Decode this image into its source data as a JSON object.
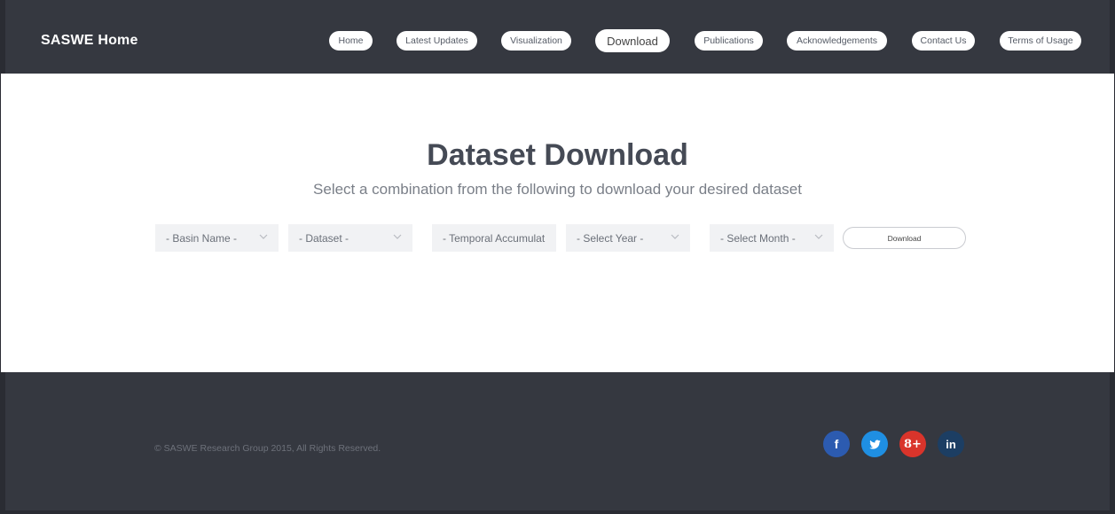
{
  "brand": "SASWE Home",
  "nav": {
    "items": [
      {
        "label": "Home"
      },
      {
        "label": "Latest Updates"
      },
      {
        "label": "Visualization"
      },
      {
        "label": "Download"
      },
      {
        "label": "Publications"
      },
      {
        "label": "Acknowledgements"
      },
      {
        "label": "Contact Us"
      },
      {
        "label": "Terms of Usage"
      }
    ],
    "active": "Download"
  },
  "main": {
    "title": "Dataset Download",
    "subtitle": "Select a combination from the following to download your desired dataset",
    "selects": {
      "basin": "- Basin Name -",
      "dataset": "- Dataset -",
      "temporal": "- Temporal Accumulat",
      "year": "- Select Year -",
      "month": "- Select Month -"
    },
    "download_label": "Download"
  },
  "footer": {
    "copyright": "© SASWE Research Group 2015, All Rights Reserved.",
    "social": [
      {
        "icon": "facebook-icon",
        "glyph": "f",
        "color": "#2c5bb0"
      },
      {
        "icon": "twitter-icon",
        "glyph": "t",
        "color": "#1f8fe2"
      },
      {
        "icon": "google-plus-icon",
        "glyph": "8+",
        "color": "#d9342b"
      },
      {
        "icon": "linkedin-icon",
        "glyph": "in",
        "color": "#1c3e63"
      }
    ]
  },
  "colors": {
    "header_bg": "#353840",
    "footer_bg": "#353840",
    "title": "#454a55"
  }
}
